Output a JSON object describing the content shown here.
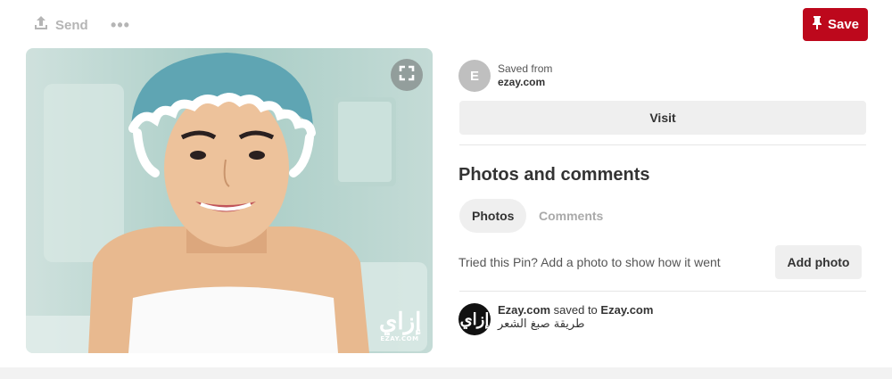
{
  "toolbar": {
    "send_label": "Send",
    "more_label": "•••",
    "save_label": "Save"
  },
  "pin": {
    "watermark_script": "إزاي",
    "watermark_latin": "EZAY.COM"
  },
  "source": {
    "avatar_letter": "E",
    "saved_from": "Saved from",
    "domain": "ezay.com",
    "visit_label": "Visit"
  },
  "photos_comments": {
    "title": "Photos and comments",
    "tabs": [
      {
        "label": "Photos",
        "active": true
      },
      {
        "label": "Comments",
        "active": false
      }
    ],
    "tried_text": "Tried this Pin? Add a photo to show how it went",
    "add_photo_label": "Add photo"
  },
  "saver": {
    "avatar_text": "إزاي",
    "name": "Ezay.com",
    "saved_to_text": "saved to",
    "board": "Ezay.com",
    "description": "طريقة صبغ الشعر"
  },
  "colors": {
    "brand_red": "#bd081c",
    "button_gray": "#efefef",
    "muted_text": "#b5b5b5"
  },
  "icons": {
    "send": "upload-arrow-icon",
    "save": "pushpin-icon",
    "expand": "expand-icon"
  }
}
